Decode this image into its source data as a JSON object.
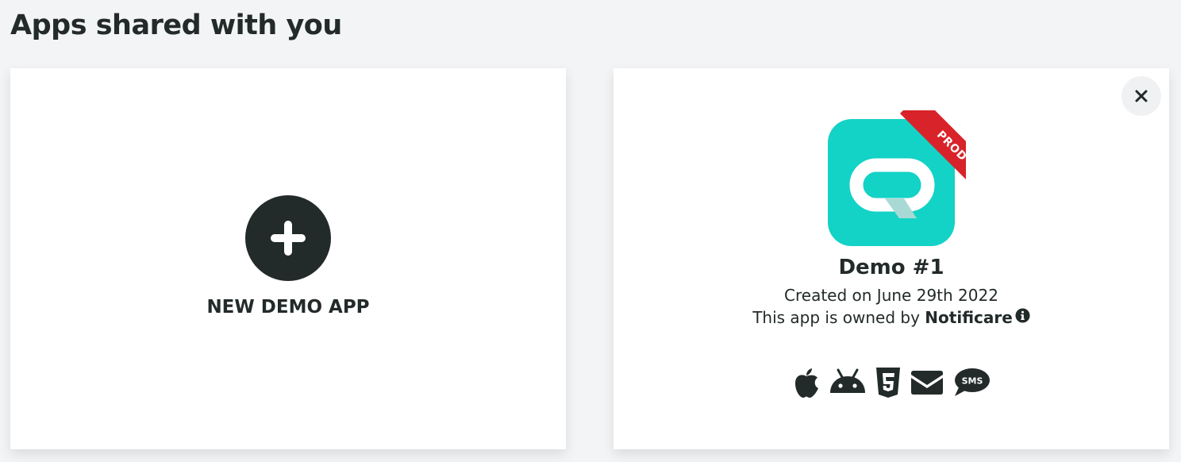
{
  "page": {
    "title": "Apps shared with you"
  },
  "new_app_card": {
    "label": "NEW DEMO APP",
    "icon": "plus-icon"
  },
  "app_card": {
    "name": "Demo #1",
    "badge": "PROD",
    "created": "Created on June 29th 2022",
    "owned_prefix": "This app is owned by ",
    "owner": "Notificare",
    "icon_color": "#13d2c6",
    "badge_color": "#d8232a",
    "platforms": [
      "apple-icon",
      "android-icon",
      "html5-icon",
      "email-icon",
      "sms-icon"
    ],
    "sms_label": "SMS"
  }
}
